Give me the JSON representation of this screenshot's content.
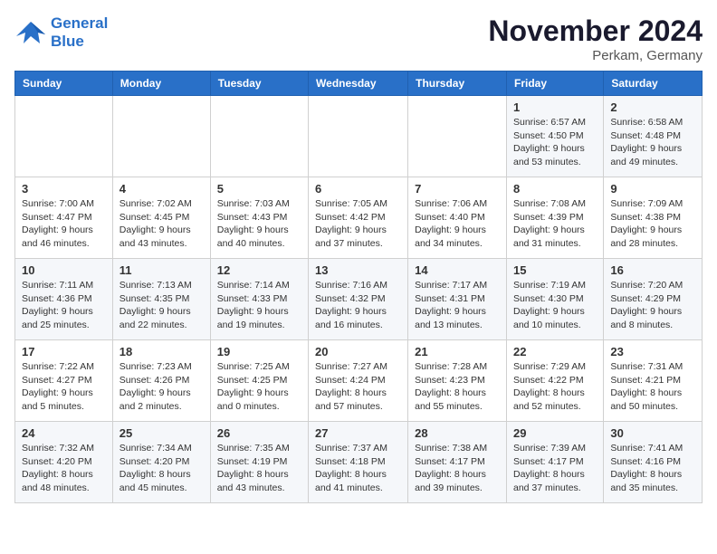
{
  "header": {
    "logo_line1": "General",
    "logo_line2": "Blue",
    "month_title": "November 2024",
    "location": "Perkam, Germany"
  },
  "days_of_week": [
    "Sunday",
    "Monday",
    "Tuesday",
    "Wednesday",
    "Thursday",
    "Friday",
    "Saturday"
  ],
  "weeks": [
    [
      {
        "day": "",
        "info": ""
      },
      {
        "day": "",
        "info": ""
      },
      {
        "day": "",
        "info": ""
      },
      {
        "day": "",
        "info": ""
      },
      {
        "day": "",
        "info": ""
      },
      {
        "day": "1",
        "info": "Sunrise: 6:57 AM\nSunset: 4:50 PM\nDaylight: 9 hours\nand 53 minutes."
      },
      {
        "day": "2",
        "info": "Sunrise: 6:58 AM\nSunset: 4:48 PM\nDaylight: 9 hours\nand 49 minutes."
      }
    ],
    [
      {
        "day": "3",
        "info": "Sunrise: 7:00 AM\nSunset: 4:47 PM\nDaylight: 9 hours\nand 46 minutes."
      },
      {
        "day": "4",
        "info": "Sunrise: 7:02 AM\nSunset: 4:45 PM\nDaylight: 9 hours\nand 43 minutes."
      },
      {
        "day": "5",
        "info": "Sunrise: 7:03 AM\nSunset: 4:43 PM\nDaylight: 9 hours\nand 40 minutes."
      },
      {
        "day": "6",
        "info": "Sunrise: 7:05 AM\nSunset: 4:42 PM\nDaylight: 9 hours\nand 37 minutes."
      },
      {
        "day": "7",
        "info": "Sunrise: 7:06 AM\nSunset: 4:40 PM\nDaylight: 9 hours\nand 34 minutes."
      },
      {
        "day": "8",
        "info": "Sunrise: 7:08 AM\nSunset: 4:39 PM\nDaylight: 9 hours\nand 31 minutes."
      },
      {
        "day": "9",
        "info": "Sunrise: 7:09 AM\nSunset: 4:38 PM\nDaylight: 9 hours\nand 28 minutes."
      }
    ],
    [
      {
        "day": "10",
        "info": "Sunrise: 7:11 AM\nSunset: 4:36 PM\nDaylight: 9 hours\nand 25 minutes."
      },
      {
        "day": "11",
        "info": "Sunrise: 7:13 AM\nSunset: 4:35 PM\nDaylight: 9 hours\nand 22 minutes."
      },
      {
        "day": "12",
        "info": "Sunrise: 7:14 AM\nSunset: 4:33 PM\nDaylight: 9 hours\nand 19 minutes."
      },
      {
        "day": "13",
        "info": "Sunrise: 7:16 AM\nSunset: 4:32 PM\nDaylight: 9 hours\nand 16 minutes."
      },
      {
        "day": "14",
        "info": "Sunrise: 7:17 AM\nSunset: 4:31 PM\nDaylight: 9 hours\nand 13 minutes."
      },
      {
        "day": "15",
        "info": "Sunrise: 7:19 AM\nSunset: 4:30 PM\nDaylight: 9 hours\nand 10 minutes."
      },
      {
        "day": "16",
        "info": "Sunrise: 7:20 AM\nSunset: 4:29 PM\nDaylight: 9 hours\nand 8 minutes."
      }
    ],
    [
      {
        "day": "17",
        "info": "Sunrise: 7:22 AM\nSunset: 4:27 PM\nDaylight: 9 hours\nand 5 minutes."
      },
      {
        "day": "18",
        "info": "Sunrise: 7:23 AM\nSunset: 4:26 PM\nDaylight: 9 hours\nand 2 minutes."
      },
      {
        "day": "19",
        "info": "Sunrise: 7:25 AM\nSunset: 4:25 PM\nDaylight: 9 hours\nand 0 minutes."
      },
      {
        "day": "20",
        "info": "Sunrise: 7:27 AM\nSunset: 4:24 PM\nDaylight: 8 hours\nand 57 minutes."
      },
      {
        "day": "21",
        "info": "Sunrise: 7:28 AM\nSunset: 4:23 PM\nDaylight: 8 hours\nand 55 minutes."
      },
      {
        "day": "22",
        "info": "Sunrise: 7:29 AM\nSunset: 4:22 PM\nDaylight: 8 hours\nand 52 minutes."
      },
      {
        "day": "23",
        "info": "Sunrise: 7:31 AM\nSunset: 4:21 PM\nDaylight: 8 hours\nand 50 minutes."
      }
    ],
    [
      {
        "day": "24",
        "info": "Sunrise: 7:32 AM\nSunset: 4:20 PM\nDaylight: 8 hours\nand 48 minutes."
      },
      {
        "day": "25",
        "info": "Sunrise: 7:34 AM\nSunset: 4:20 PM\nDaylight: 8 hours\nand 45 minutes."
      },
      {
        "day": "26",
        "info": "Sunrise: 7:35 AM\nSunset: 4:19 PM\nDaylight: 8 hours\nand 43 minutes."
      },
      {
        "day": "27",
        "info": "Sunrise: 7:37 AM\nSunset: 4:18 PM\nDaylight: 8 hours\nand 41 minutes."
      },
      {
        "day": "28",
        "info": "Sunrise: 7:38 AM\nSunset: 4:17 PM\nDaylight: 8 hours\nand 39 minutes."
      },
      {
        "day": "29",
        "info": "Sunrise: 7:39 AM\nSunset: 4:17 PM\nDaylight: 8 hours\nand 37 minutes."
      },
      {
        "day": "30",
        "info": "Sunrise: 7:41 AM\nSunset: 4:16 PM\nDaylight: 8 hours\nand 35 minutes."
      }
    ]
  ]
}
